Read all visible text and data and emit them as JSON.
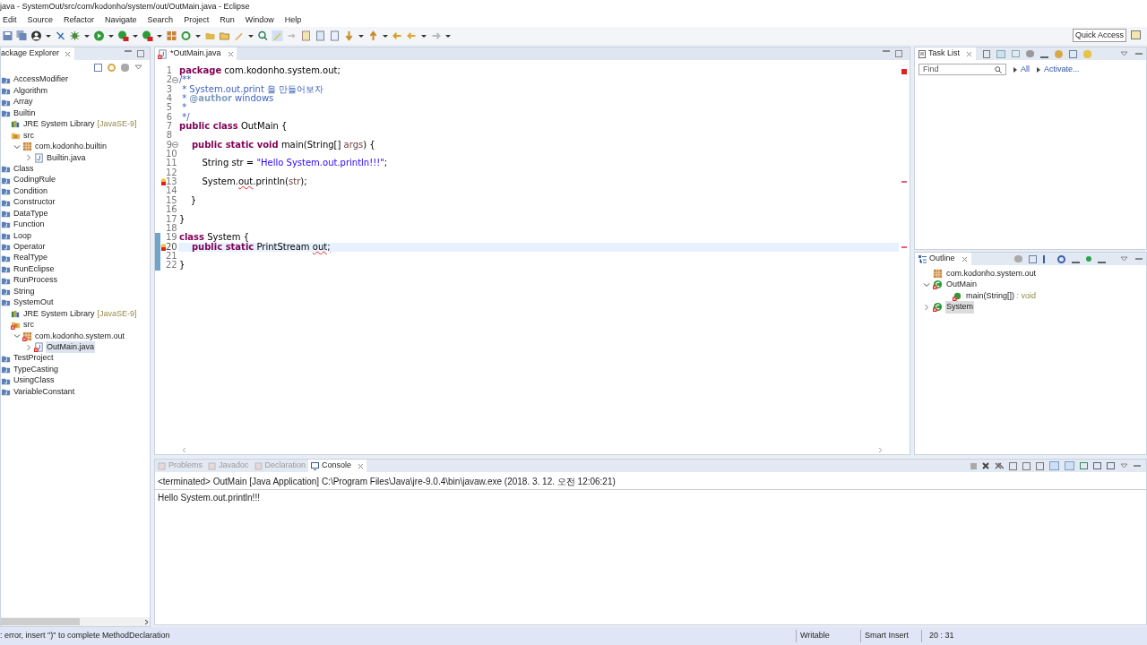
{
  "window": {
    "title": "java - SystemOut/src/com/kodonho/system/out/OutMain.java - Eclipse"
  },
  "menu": [
    "Edit",
    "Source",
    "Refactor",
    "Navigate",
    "Search",
    "Project",
    "Run",
    "Window",
    "Help"
  ],
  "toolbar": {
    "quick_access": "Quick Access"
  },
  "package_explorer": {
    "title": "ackage Explorer",
    "items": [
      {
        "label": "AccessModifier",
        "kind": "project",
        "error": false
      },
      {
        "label": "Algorithm",
        "kind": "project",
        "error": false
      },
      {
        "label": "Array",
        "kind": "project",
        "error": false
      },
      {
        "label": "Builtin",
        "kind": "project",
        "error": false,
        "children": [
          {
            "label": "JRE System Library",
            "decoration": "[JavaSE-9]",
            "kind": "library",
            "error": false
          },
          {
            "label": "src",
            "kind": "src",
            "error": false,
            "children": [
              {
                "label": "com.kodonho.builtin",
                "kind": "package",
                "expanded": true,
                "error": false,
                "children": [
                  {
                    "label": "Builtin.java",
                    "kind": "file",
                    "expanded": false,
                    "error": false,
                    "selected": false
                  }
                ]
              }
            ]
          }
        ]
      },
      {
        "label": "Class",
        "kind": "project",
        "error": false
      },
      {
        "label": "CodingRule",
        "kind": "project",
        "error": false
      },
      {
        "label": "Condition",
        "kind": "project",
        "error": false
      },
      {
        "label": "Constructor",
        "kind": "project",
        "error": false
      },
      {
        "label": "DataType",
        "kind": "project",
        "error": false
      },
      {
        "label": "Function",
        "kind": "project",
        "error": false
      },
      {
        "label": "Loop",
        "kind": "project",
        "error": false
      },
      {
        "label": "Operator",
        "kind": "project",
        "error": false
      },
      {
        "label": "RealType",
        "kind": "project",
        "error": false
      },
      {
        "label": "RunEclipse",
        "kind": "project",
        "error": false
      },
      {
        "label": "RunProcess",
        "kind": "project",
        "error": false
      },
      {
        "label": "String",
        "kind": "project",
        "error": false
      },
      {
        "label": "SystemOut",
        "kind": "project",
        "error": false,
        "children": [
          {
            "label": "JRE System Library",
            "decoration": "[JavaSE-9]",
            "kind": "library",
            "error": false
          },
          {
            "label": "src",
            "kind": "src",
            "error": true,
            "children": [
              {
                "label": "com.kodonho.system.out",
                "kind": "package",
                "expanded": true,
                "error": true,
                "children": [
                  {
                    "label": "OutMain.java",
                    "kind": "file",
                    "expanded": false,
                    "error": true,
                    "selected": true
                  }
                ]
              }
            ]
          }
        ]
      },
      {
        "label": "TestProject",
        "kind": "project",
        "error": false
      },
      {
        "label": "TypeCasting",
        "kind": "project",
        "error": false
      },
      {
        "label": "UsingClass",
        "kind": "project",
        "error": false
      },
      {
        "label": "VariableConstant",
        "kind": "project",
        "error": false
      }
    ]
  },
  "editor": {
    "tab": "*OutMain.java",
    "lines": [
      {
        "num": "1",
        "fold": false,
        "problem": false,
        "changed": false,
        "current": false,
        "tokens": [
          {
            "t": "package",
            "kind": "kw"
          },
          {
            "t": " com.kodonho.system.out;",
            "kind": "plain"
          }
        ]
      },
      {
        "num": "2",
        "fold": true,
        "problem": false,
        "changed": false,
        "current": false,
        "tokens": [
          {
            "t": "/**",
            "kind": "doc"
          }
        ]
      },
      {
        "num": "3",
        "fold": false,
        "problem": false,
        "changed": false,
        "current": false,
        "tokens": [
          {
            "t": " * System.out.print 을 만들어보자",
            "kind": "doc"
          }
        ]
      },
      {
        "num": "4",
        "fold": false,
        "problem": false,
        "changed": false,
        "current": false,
        "tokens": [
          {
            "t": " * ",
            "kind": "doc"
          },
          {
            "t": "@author",
            "kind": "tag"
          },
          {
            "t": " windows",
            "kind": "doc"
          }
        ]
      },
      {
        "num": "5",
        "fold": false,
        "problem": false,
        "changed": false,
        "current": false,
        "tokens": [
          {
            "t": " *",
            "kind": "doc"
          }
        ]
      },
      {
        "num": "6",
        "fold": false,
        "problem": false,
        "changed": false,
        "current": false,
        "tokens": [
          {
            "t": " */",
            "kind": "doc"
          }
        ]
      },
      {
        "num": "7",
        "fold": false,
        "problem": false,
        "changed": false,
        "current": false,
        "tokens": [
          {
            "t": "public class",
            "kind": "kw"
          },
          {
            "t": " OutMain {",
            "kind": "plain"
          }
        ]
      },
      {
        "num": "8",
        "fold": false,
        "problem": false,
        "changed": false,
        "current": false
      },
      {
        "num": "9",
        "fold": true,
        "problem": false,
        "changed": false,
        "current": false,
        "tokens": [
          {
            "t": "    public static void",
            "kind": "kw"
          },
          {
            "t": " main(String[] ",
            "kind": "plain"
          },
          {
            "t": "args",
            "kind": "param"
          },
          {
            "t": ") {",
            "kind": "plain"
          }
        ]
      },
      {
        "num": "10",
        "fold": false,
        "problem": false,
        "changed": false,
        "current": false
      },
      {
        "num": "11",
        "fold": false,
        "problem": false,
        "changed": false,
        "current": false,
        "tokens": [
          {
            "t": "        String str = ",
            "kind": "plain"
          },
          {
            "t": "\"Hello System.out.println!!!\"",
            "kind": "string"
          },
          {
            "t": ";",
            "kind": "plain"
          }
        ]
      },
      {
        "num": "12",
        "fold": false,
        "problem": false,
        "changed": false,
        "current": false
      },
      {
        "num": "13",
        "fold": false,
        "problem": true,
        "changed": false,
        "current": false,
        "tokens": [
          {
            "t": "        System.",
            "kind": "plain"
          },
          {
            "t": "out",
            "kind": "error"
          },
          {
            "t": ".println(",
            "kind": "plain"
          },
          {
            "t": "str",
            "kind": "param"
          },
          {
            "t": ");",
            "kind": "plain"
          }
        ]
      },
      {
        "num": "14",
        "fold": false,
        "problem": false,
        "changed": false,
        "current": false
      },
      {
        "num": "15",
        "fold": false,
        "problem": false,
        "changed": false,
        "current": false,
        "tokens": [
          {
            "t": "    }",
            "kind": "plain"
          }
        ]
      },
      {
        "num": "16",
        "fold": false,
        "problem": false,
        "changed": false,
        "current": false
      },
      {
        "num": "17",
        "fold": false,
        "problem": false,
        "changed": false,
        "current": false,
        "tokens": [
          {
            "t": "}",
            "kind": "plain"
          }
        ]
      },
      {
        "num": "18",
        "fold": false,
        "problem": false,
        "changed": false,
        "current": false
      },
      {
        "num": "19",
        "fold": false,
        "problem": false,
        "changed": true,
        "current": false,
        "tokens": [
          {
            "t": "class",
            "kind": "kw"
          },
          {
            "t": " System {",
            "kind": "plain"
          }
        ]
      },
      {
        "num": "20",
        "fold": false,
        "problem": true,
        "changed": true,
        "current": true,
        "tokens": [
          {
            "t": "    public static",
            "kind": "kw"
          },
          {
            "t": " PrintStream ",
            "kind": "plain"
          },
          {
            "t": "out;",
            "kind": "error"
          }
        ]
      },
      {
        "num": "21",
        "fold": false,
        "problem": false,
        "changed": true,
        "current": false
      },
      {
        "num": "22",
        "fold": false,
        "problem": false,
        "changed": true,
        "current": false,
        "tokens": [
          {
            "t": "}",
            "kind": "plain"
          }
        ]
      }
    ]
  },
  "task_list": {
    "title": "Task List",
    "find_placeholder": "Find",
    "links": [
      "All",
      "Activate..."
    ]
  },
  "outline": {
    "title": "Outline",
    "items": [
      {
        "label": "com.kodonho.system.out",
        "kind": "package",
        "selected": false
      },
      {
        "label": "OutMain",
        "kind": "class",
        "expanded": true,
        "selected": false,
        "children": [
          {
            "label": "main(String[])",
            "type": " : void",
            "kind": "method",
            "selected": false
          }
        ]
      },
      {
        "label": "System",
        "kind": "class",
        "expanded": false,
        "selected": true
      }
    ]
  },
  "console": {
    "tabs": [
      {
        "label": "Problems",
        "selected": false
      },
      {
        "label": "Javadoc",
        "selected": false
      },
      {
        "label": "Declaration",
        "selected": false
      },
      {
        "label": "Console",
        "selected": true
      }
    ],
    "header": "<terminated> OutMain [Java Application] C:\\Program Files\\Java\\jre-9.0.4\\bin\\javaw.exe (2018. 3. 12. 오전 12:06:21)",
    "output": "Hello System.out.println!!!"
  },
  "status_bar": {
    "message": ": error, insert \")\" to complete MethodDeclaration",
    "mode": "Writable",
    "insert_mode": "Smart Insert",
    "position": "20 : 31"
  }
}
